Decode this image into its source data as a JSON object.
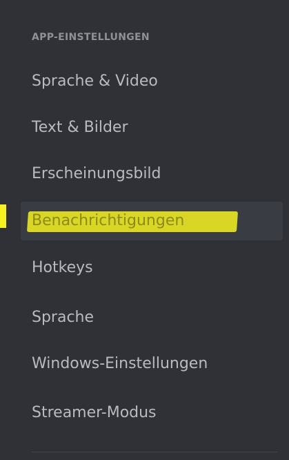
{
  "sidebar": {
    "section_header": "APP-EINSTELLUNGEN",
    "items": [
      {
        "label": "Sprache & Video"
      },
      {
        "label": "Text & Bilder"
      },
      {
        "label": "Erscheinungsbild"
      },
      {
        "label": "Benachrichtigungen",
        "selected": true,
        "highlighted": true
      },
      {
        "label": "Hotkeys"
      },
      {
        "label": "Sprache"
      },
      {
        "label": "Windows-Einstellungen"
      },
      {
        "label": "Streamer-Modus"
      }
    ]
  },
  "colors": {
    "sidebar_background": "#2f3136",
    "section_header": "#8e9297",
    "item_text": "#b9bbbe",
    "selected_background": "#393c43",
    "highlighter": "#f7f21e"
  }
}
